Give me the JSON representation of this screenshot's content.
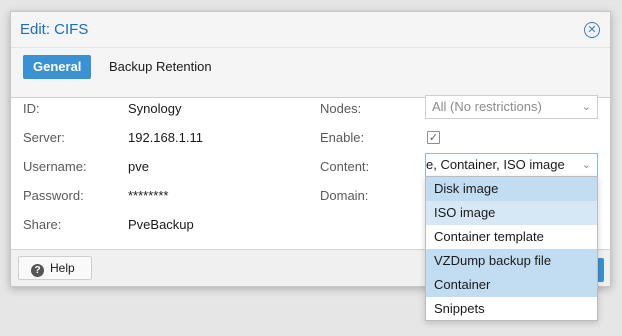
{
  "dialog": {
    "title": "Edit: CIFS",
    "close_icon": "close-circle-icon"
  },
  "tabs": [
    {
      "label": "General",
      "active": true
    },
    {
      "label": "Backup Retention",
      "active": false
    }
  ],
  "form": {
    "left": [
      {
        "label": "ID:",
        "value": "Synology"
      },
      {
        "label": "Server:",
        "value": "192.168.1.11"
      },
      {
        "label": "Username:",
        "value": "pve"
      },
      {
        "label": "Password:",
        "value": "********"
      },
      {
        "label": "Share:",
        "value": "PveBackup"
      }
    ],
    "right": {
      "nodes_label": "Nodes:",
      "nodes_value": "All (No restrictions)",
      "enable_label": "Enable:",
      "enable_checked": true,
      "content_label": "Content:",
      "content_value": "e, Container, ISO image",
      "domain_label": "Domain:"
    }
  },
  "content_dropdown": {
    "options": [
      {
        "label": "Disk image",
        "selected": true
      },
      {
        "label": "ISO image",
        "selected": true
      },
      {
        "label": "Container template",
        "selected": false
      },
      {
        "label": "VZDump backup file",
        "selected": true
      },
      {
        "label": "Container",
        "selected": true
      },
      {
        "label": "Snippets",
        "selected": false
      }
    ]
  },
  "footer": {
    "help_label": "Help",
    "help_icon": "question-circle-icon"
  },
  "colors": {
    "accent": "#3892d4",
    "title": "#1a6fb5",
    "selected_option": "#c2dcf2"
  }
}
